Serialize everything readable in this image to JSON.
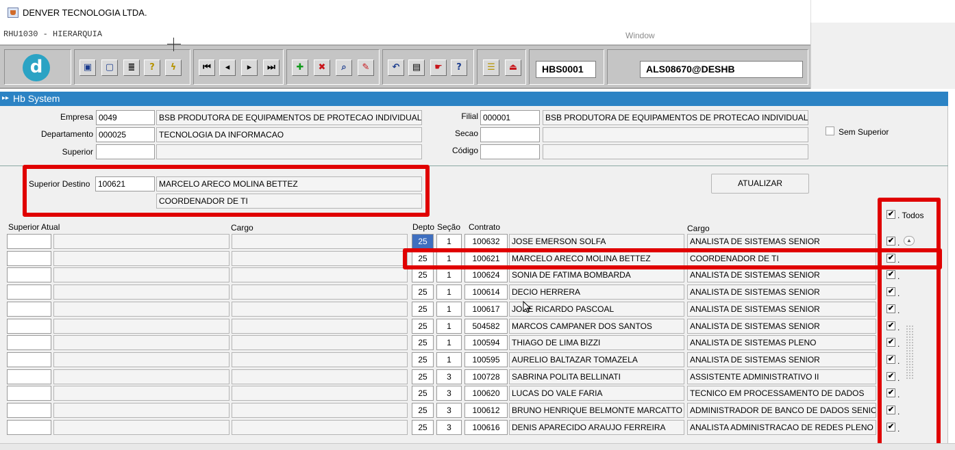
{
  "window": {
    "title": "DENVER TECNOLOGIA LTDA.",
    "form_name": "RHU1030 - HIERARQUIA",
    "menu_window": "Window"
  },
  "toolbar": {
    "logo_letter": "d",
    "buttons": [
      {
        "icon": "save-icon",
        "glyph": "▣"
      },
      {
        "icon": "window-icon",
        "glyph": "▢"
      },
      {
        "icon": "print-icon",
        "glyph": "≣"
      },
      {
        "icon": "query-help-icon",
        "glyph": "?"
      },
      {
        "icon": "execute-query-icon",
        "glyph": "ϟ"
      },
      {
        "icon": "first-record-icon",
        "glyph": "⏮"
      },
      {
        "icon": "previous-record-icon",
        "glyph": "◂"
      },
      {
        "icon": "next-record-icon",
        "glyph": "▸"
      },
      {
        "icon": "last-record-icon",
        "glyph": "⏭"
      },
      {
        "icon": "insert-record-icon",
        "glyph": "✚"
      },
      {
        "icon": "delete-record-icon",
        "glyph": "✖"
      },
      {
        "icon": "search-record-icon",
        "glyph": "⌕"
      },
      {
        "icon": "edit-record-icon",
        "glyph": "✎"
      },
      {
        "icon": "undo-icon",
        "glyph": "↶"
      },
      {
        "icon": "clipboard-icon",
        "glyph": "▤"
      },
      {
        "icon": "hand-icon",
        "glyph": "☛"
      },
      {
        "icon": "help-icon",
        "glyph": "?"
      },
      {
        "icon": "menu-icon",
        "glyph": "☰"
      },
      {
        "icon": "exit-icon",
        "glyph": "⏏"
      }
    ],
    "screen_code": "HBS0001",
    "user_info": "ALS08670@DESHB"
  },
  "panel": {
    "title": "Hb System",
    "empresa": {
      "label": "Empresa",
      "code": "0049",
      "name": "BSB PRODUTORA DE EQUIPAMENTOS DE  PROTECAO INDIVIDUAL S"
    },
    "filial": {
      "label": "Filial",
      "code": "000001",
      "name": "BSB PRODUTORA DE EQUIPAMENTOS DE PROTECAO INDIVIDUAL S."
    },
    "departamento": {
      "label": "Departamento",
      "code": "000025",
      "name": "TECNOLOGIA DA INFORMACAO"
    },
    "secao": {
      "label": "Secao",
      "code": "",
      "name": ""
    },
    "superior": {
      "label": "Superior",
      "code": "",
      "name": ""
    },
    "codigo": {
      "label": "Código",
      "code": "",
      "name": ""
    },
    "sem_superior": "Sem Superior",
    "superior_destino": {
      "label": "Superior Destino",
      "code": "100621",
      "name": "MARCELO ARECO MOLINA BETTEZ",
      "cargo": "COORDENADOR DE TI"
    },
    "atualizar_label": "ATUALIZAR",
    "todos_label": "Todos"
  },
  "grid": {
    "headers": {
      "superior_atual": "Superior Atual",
      "cargo_left": "Cargo",
      "depto": "Depto",
      "secao": "Seção",
      "contrato": "Contrato",
      "cargo_right": "Cargo"
    },
    "rows": [
      {
        "depto": "25",
        "secao": "1",
        "contrato": "100632",
        "nome": "JOSE EMERSON SOLFA",
        "cargo": "ANALISTA DE SISTEMAS SENIOR",
        "checked": "✔"
      },
      {
        "depto": "25",
        "secao": "1",
        "contrato": "100621",
        "nome": "MARCELO ARECO MOLINA BETTEZ",
        "cargo": "COORDENADOR DE TI",
        "checked": "✔"
      },
      {
        "depto": "25",
        "secao": "1",
        "contrato": "100624",
        "nome": "SONIA DE FATIMA BOMBARDA",
        "cargo": "ANALISTA DE SISTEMAS SENIOR",
        "checked": "✔"
      },
      {
        "depto": "25",
        "secao": "1",
        "contrato": "100614",
        "nome": "DECIO HERRERA",
        "cargo": "ANALISTA DE SISTEMAS SENIOR",
        "checked": "✔"
      },
      {
        "depto": "25",
        "secao": "1",
        "contrato": "100617",
        "nome": "JOSE RICARDO PASCOAL",
        "cargo": "ANALISTA DE SISTEMAS SENIOR",
        "checked": "✔"
      },
      {
        "depto": "25",
        "secao": "1",
        "contrato": "504582",
        "nome": "MARCOS CAMPANER DOS SANTOS",
        "cargo": "ANALISTA DE SISTEMAS SENIOR",
        "checked": "✔"
      },
      {
        "depto": "25",
        "secao": "1",
        "contrato": "100594",
        "nome": "THIAGO DE LIMA BIZZI",
        "cargo": "ANALISTA DE SISTEMAS PLENO",
        "checked": "✔"
      },
      {
        "depto": "25",
        "secao": "1",
        "contrato": "100595",
        "nome": "AURELIO BALTAZAR TOMAZELA",
        "cargo": "ANALISTA DE SISTEMAS SENIOR",
        "checked": "✔"
      },
      {
        "depto": "25",
        "secao": "3",
        "contrato": "100728",
        "nome": "SABRINA POLITA BELLINATI",
        "cargo": "ASSISTENTE ADMINISTRATIVO II",
        "checked": "✔"
      },
      {
        "depto": "25",
        "secao": "3",
        "contrato": "100620",
        "nome": "LUCAS DO VALE FARIA",
        "cargo": "TECNICO EM PROCESSAMENTO DE DADOS",
        "checked": "✔"
      },
      {
        "depto": "25",
        "secao": "3",
        "contrato": "100612",
        "nome": "BRUNO HENRIQUE BELMONTE MARCATTO",
        "cargo": "ADMINISTRADOR DE BANCO DE DADOS SENIOR",
        "checked": "✔"
      },
      {
        "depto": "25",
        "secao": "3",
        "contrato": "100616",
        "nome": "DENIS APARECIDO ARAUJO FERREIRA",
        "cargo": "ANALISTA ADMINISTRACAO DE REDES PLENO",
        "checked": "✔"
      }
    ]
  },
  "colors": {
    "highlight": "#e00000",
    "panel_bar": "#2c83c4",
    "logo": "#2ba3c4"
  }
}
